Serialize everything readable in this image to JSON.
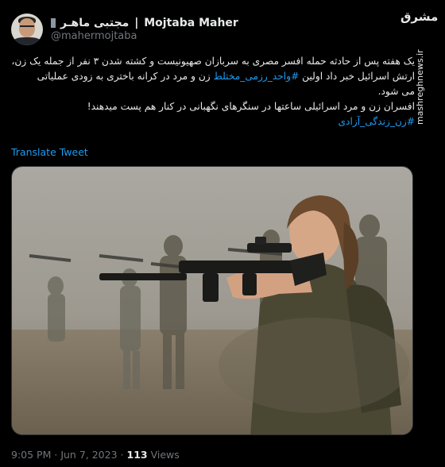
{
  "author": {
    "display_name": "Mojtaba Maher",
    "display_name_alt": "مجتبی ماهـر",
    "handle": "@mahermojtaba"
  },
  "site_logo": "مشرق",
  "watermark": "mashreghnews.ir",
  "tweet": {
    "lines": [
      "یک هفته پس از حادثه حمله افسر مصری به سربازان صهیونیست و کشته شدن ۳ نفر از جمله یک زن،",
      "ارتش اسرائیل خبر داد اولین",
      "زن و مرد در کرانه باختری به زودی عملیاتی",
      "می شود.",
      "افسران زن و مرد اسرائیلی ساعتها در سنگرهای نگهبانی در کنار هم پست میدهند!"
    ],
    "hashtag_inline": "#واحد_رزمی_مختلط",
    "hashtag_end": "#زن_زندگی_آزادی",
    "translate_label": "Translate Tweet"
  },
  "meta": {
    "time": "9:05 PM",
    "separator": "·",
    "date": "Jun 7, 2023",
    "views_count": "113",
    "views_label": "Views"
  },
  "colors": {
    "background": "#000000",
    "text": "#e7e9ea",
    "secondary": "#71767b",
    "link": "#1d9bf0"
  }
}
